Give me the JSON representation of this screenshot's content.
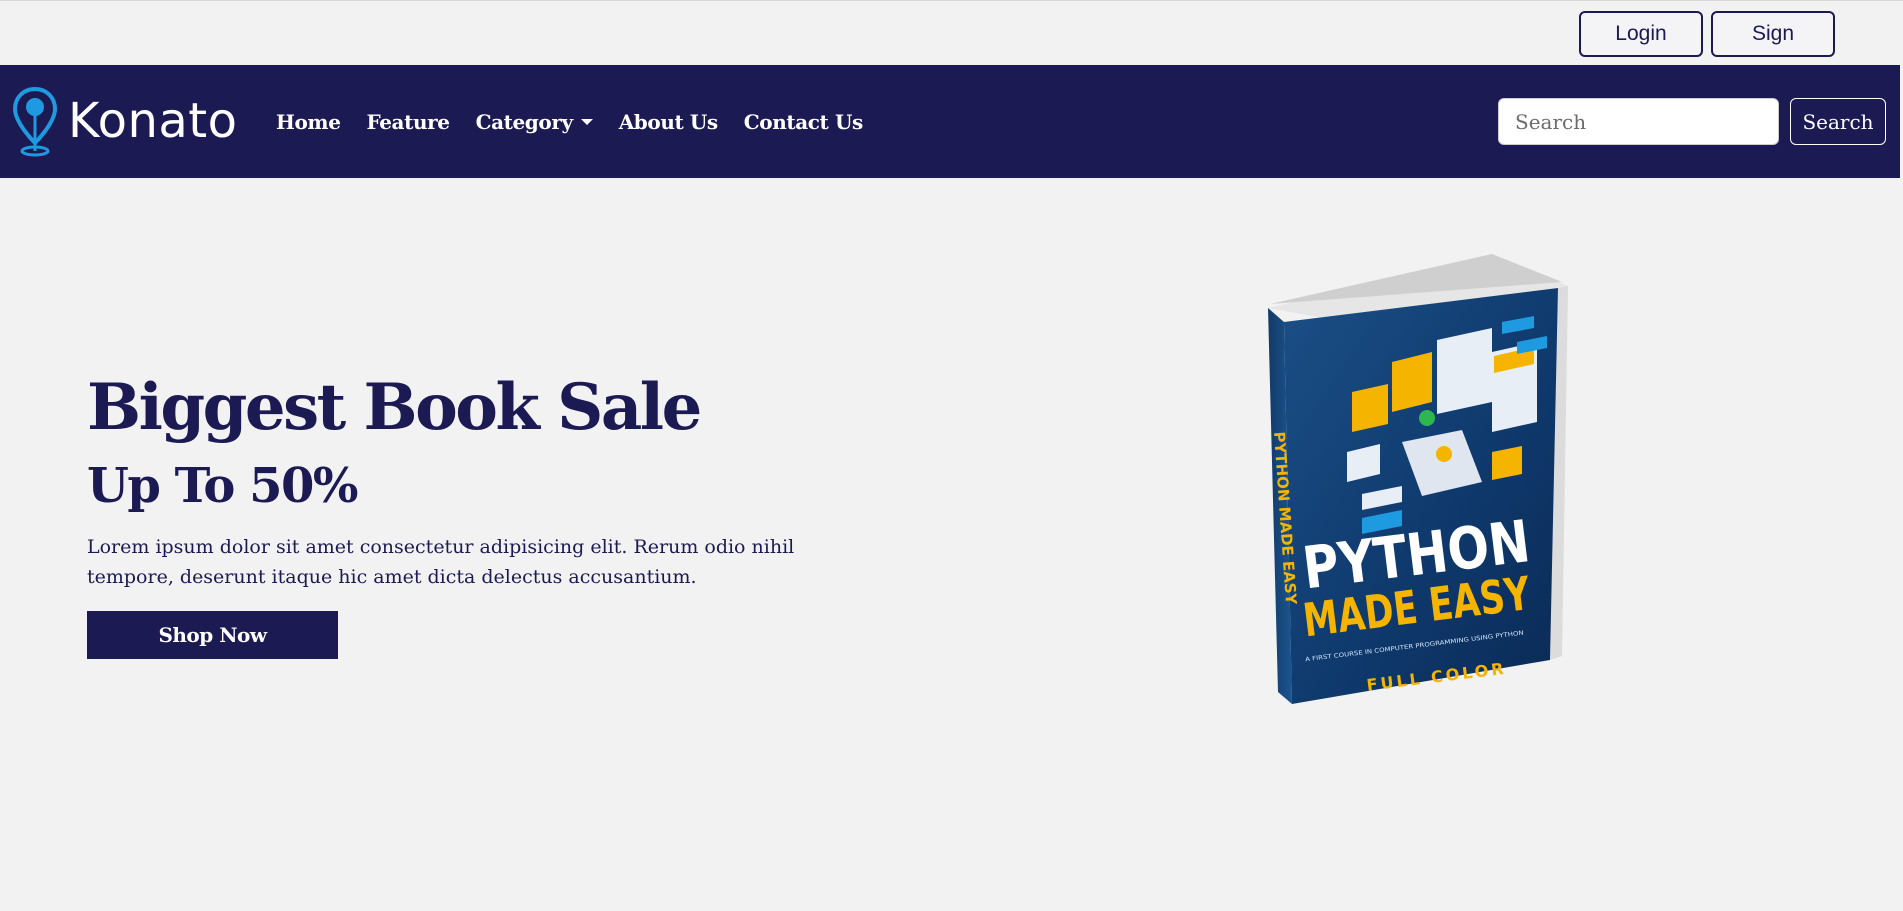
{
  "topbar": {
    "login_label": "Login",
    "sign_label": "Sign"
  },
  "navbar": {
    "brand_name": "Konato",
    "links": [
      {
        "label": "Home"
      },
      {
        "label": "Feature"
      },
      {
        "label": "Category",
        "dropdown": true
      },
      {
        "label": "About Us"
      },
      {
        "label": "Contact Us"
      }
    ],
    "search": {
      "placeholder": "Search",
      "value": "",
      "button_label": "Search"
    }
  },
  "hero": {
    "title": "Biggest Book Sale",
    "subtitle": "Up To 50%",
    "description": "Lorem ipsum dolor sit amet consectetur adipisicing elit. Rerum odio nihil tempore, deserunt itaque hic amet dicta delectus accusantium.",
    "button_label": "Shop Now",
    "book": {
      "title_line1": "PYTHON",
      "title_line2": "MADE EASY",
      "tagline": "A FIRST COURSE IN COMPUTER PROGRAMMING USING PYTHON",
      "edition": "FULL COLOR",
      "spine": "PYTHON MADE EASY"
    }
  },
  "colors": {
    "navy": "#1c1a52",
    "background": "#f2f2f2",
    "logo_blue": "#1e9be0",
    "book_yellow": "#f5b400"
  }
}
